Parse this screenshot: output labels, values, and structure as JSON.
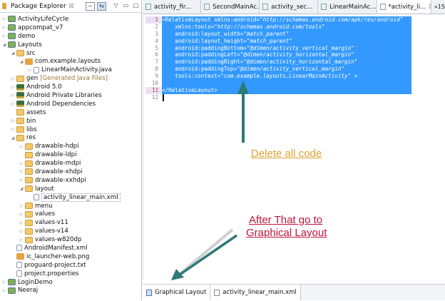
{
  "package_explorer": {
    "title": "Package Explorer",
    "close": "☒",
    "items": [
      {
        "label": "ActivityLifeCycle",
        "level": 0,
        "twisty": "▷",
        "icon": "proj"
      },
      {
        "label": "appcompat_v7",
        "level": 0,
        "twisty": "▷",
        "icon": "proj"
      },
      {
        "label": "demo",
        "level": 0,
        "twisty": "▷",
        "icon": "proj"
      },
      {
        "label": "Layouts",
        "level": 0,
        "twisty": "◢",
        "icon": "proj"
      },
      {
        "label": "src",
        "level": 1,
        "twisty": "◢",
        "icon": "fold"
      },
      {
        "label": "com.example.layouts",
        "level": 2,
        "twisty": "◢",
        "icon": "pkg"
      },
      {
        "label": "LinearMainActivity.java",
        "level": 3,
        "twisty": "▷",
        "icon": "file"
      },
      {
        "label": "gen",
        "extra": "[Generated Java Files]",
        "level": 1,
        "twisty": "▷",
        "icon": "fold"
      },
      {
        "label": "Android 5.0",
        "level": 1,
        "twisty": "▷",
        "icon": "lib"
      },
      {
        "label": "Android Private Libraries",
        "level": 1,
        "twisty": "▷",
        "icon": "lib"
      },
      {
        "label": "Android Dependencies",
        "level": 1,
        "twisty": "▷",
        "icon": "lib"
      },
      {
        "label": "assets",
        "level": 1,
        "twisty": "",
        "icon": "fold"
      },
      {
        "label": "bin",
        "level": 1,
        "twisty": "▷",
        "icon": "fold"
      },
      {
        "label": "libs",
        "level": 1,
        "twisty": "▷",
        "icon": "fold"
      },
      {
        "label": "res",
        "level": 1,
        "twisty": "◢",
        "icon": "fold"
      },
      {
        "label": "drawable-hdpi",
        "level": 2,
        "twisty": "▷",
        "icon": "fold"
      },
      {
        "label": "drawable-ldpi",
        "level": 2,
        "twisty": "",
        "icon": "fold"
      },
      {
        "label": "drawable-mdpi",
        "level": 2,
        "twisty": "▷",
        "icon": "fold"
      },
      {
        "label": "drawable-xhdpi",
        "level": 2,
        "twisty": "▷",
        "icon": "fold"
      },
      {
        "label": "drawable-xxhdpi",
        "level": 2,
        "twisty": "▷",
        "icon": "fold"
      },
      {
        "label": "layout",
        "level": 2,
        "twisty": "◢",
        "icon": "fold"
      },
      {
        "label": "activity_linear_main.xml",
        "level": 3,
        "twisty": "",
        "icon": "file",
        "selected": true
      },
      {
        "label": "menu",
        "level": 2,
        "twisty": "▷",
        "icon": "fold"
      },
      {
        "label": "values",
        "level": 2,
        "twisty": "▷",
        "icon": "fold"
      },
      {
        "label": "values-v11",
        "level": 2,
        "twisty": "▷",
        "icon": "fold"
      },
      {
        "label": "values-v14",
        "level": 2,
        "twisty": "▷",
        "icon": "fold"
      },
      {
        "label": "values-w820dp",
        "level": 2,
        "twisty": "▷",
        "icon": "fold"
      },
      {
        "label": "AndroidManifest.xml",
        "level": 1,
        "twisty": "",
        "icon": "file"
      },
      {
        "label": "ic_launcher-web.png",
        "level": 1,
        "twisty": "",
        "icon": "pkg"
      },
      {
        "label": "proguard-project.txt",
        "level": 1,
        "twisty": "",
        "icon": "file"
      },
      {
        "label": "project.properties",
        "level": 1,
        "twisty": "",
        "icon": "file"
      },
      {
        "label": "LoginDemo",
        "level": 0,
        "twisty": "▷",
        "icon": "proj"
      },
      {
        "label": "Neeraj",
        "level": 0,
        "twisty": "▷",
        "icon": "proj"
      }
    ]
  },
  "editor_tabs": [
    {
      "label": "activity_fir..."
    },
    {
      "label": "SecondMainAc..."
    },
    {
      "label": "activity_sec..."
    },
    {
      "label": "LinearMainAc..."
    },
    {
      "label": "*activity_li...",
      "close": "☒",
      "active": true
    }
  ],
  "more_tabs": "»15",
  "code_lines": [
    {
      "n": "1",
      "a": "<RelativeLayout xmlns:android=",
      "v": "\"http://schemas.android.com/apk/res/android\""
    },
    {
      "n": "2",
      "a": "    xmlns:tools=",
      "v": "\"http://schemas.android.com/tools\""
    },
    {
      "n": "3",
      "a": "    android:layout_width=",
      "v": "\"match_parent\""
    },
    {
      "n": "4",
      "a": "    android:layout_height=",
      "v": "\"match_parent\""
    },
    {
      "n": "5",
      "a": "    android:paddingBottom=",
      "v": "\"@dimen/activity_vertical_margin\""
    },
    {
      "n": "6",
      "a": "    android:paddingLeft=",
      "v": "\"@dimen/activity_horizontal_margin\""
    },
    {
      "n": "7",
      "a": "    android:paddingRight=",
      "v": "\"@dimen/activity_horizontal_margin\""
    },
    {
      "n": "8",
      "a": "    android:paddingTop=",
      "v": "\"@dimen/activity_vertical_margin\""
    },
    {
      "n": "9",
      "a": "    tools:context=",
      "v": "\"com.example.layouts.LinearMainActivity\" >"
    },
    {
      "n": "10",
      "a": "",
      "v": ""
    },
    {
      "n": "11",
      "a": "</RelativeLayout>",
      "v": ""
    },
    {
      "n": "12",
      "a": "",
      "v": ""
    }
  ],
  "bottom_tabs": {
    "graphical": "Graphical Layout",
    "xml": "activity_linear_main.xml"
  },
  "annotations": {
    "delete": "Delete all code",
    "after1": "After That go to",
    "after2": "Graphical Layout"
  },
  "colors": {
    "selection": "#3399ff",
    "arrow": "#2e7a78",
    "delete": "#e0a030",
    "after": "#c0143c"
  }
}
